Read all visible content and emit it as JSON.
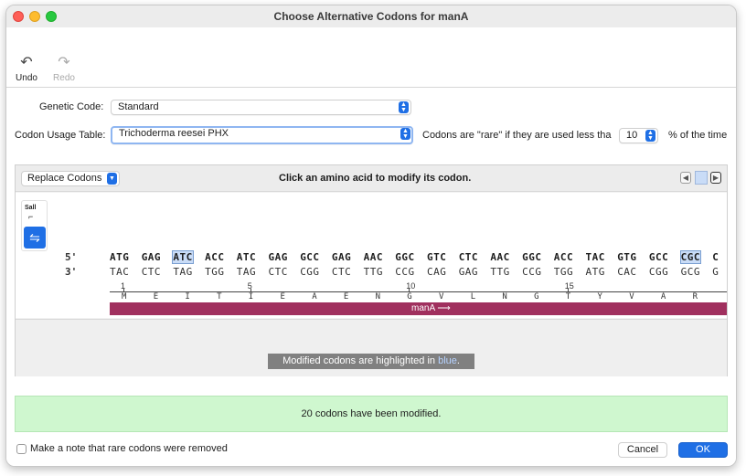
{
  "window": {
    "title": "Choose Alternative Codons for manA"
  },
  "toolbar": {
    "undo_label": "Undo",
    "redo_label": "Redo"
  },
  "form": {
    "genetic_code_label": "Genetic Code:",
    "genetic_code_value": "Standard",
    "codon_table_label": "Codon Usage Table:",
    "codon_table_value": "Trichoderma reesei PHX",
    "rare_prefix": "Codons are \"rare\" if they are used less thai",
    "rare_threshold": "10",
    "rare_suffix": "% of the time"
  },
  "sequence_panel": {
    "replace_label": "Replace Codons",
    "hint": "Click an amino acid to modify its codon.",
    "sall_label": "Sall",
    "strand_top_label": "5'",
    "strand_bottom_label": "3'",
    "top_codons": [
      "ATG",
      "GAG",
      "ATC",
      "ACC",
      "ATC",
      "GAG",
      "GCC",
      "GAG",
      "AAC",
      "GGC",
      "GTC",
      "CTC",
      "AAC",
      "GGC",
      "ACC",
      "TAC",
      "GTG",
      "GCC",
      "CGC",
      "C"
    ],
    "bottom_codons": [
      "TAC",
      "CTC",
      "TAG",
      "TGG",
      "TAG",
      "CTC",
      "CGG",
      "CTC",
      "TTG",
      "CCG",
      "CAG",
      "GAG",
      "TTG",
      "CCG",
      "TGG",
      "ATG",
      "CAC",
      "CGG",
      "GCG",
      "G"
    ],
    "modified_codon_indices": [
      2,
      18
    ],
    "ruler_ticks": [
      "1",
      "5",
      "10",
      "15"
    ],
    "amino_acids": [
      "M",
      "E",
      "I",
      "T",
      "I",
      "E",
      "A",
      "E",
      "N",
      "G",
      "V",
      "L",
      "N",
      "G",
      "T",
      "Y",
      "V",
      "A",
      "R"
    ],
    "feature_label": "manA",
    "feature_color": "#a0305e",
    "highlight_color": "#c9dcf7",
    "modified_note_prefix": "Modified codons are highlighted in ",
    "modified_note_blue": "blue",
    "modified_note_suffix": "."
  },
  "result": {
    "message": "20 codons have been modified."
  },
  "footer": {
    "note_checkbox_label": "Make a note that rare codons were removed",
    "note_checked": false,
    "cancel_label": "Cancel",
    "ok_label": "OK"
  }
}
